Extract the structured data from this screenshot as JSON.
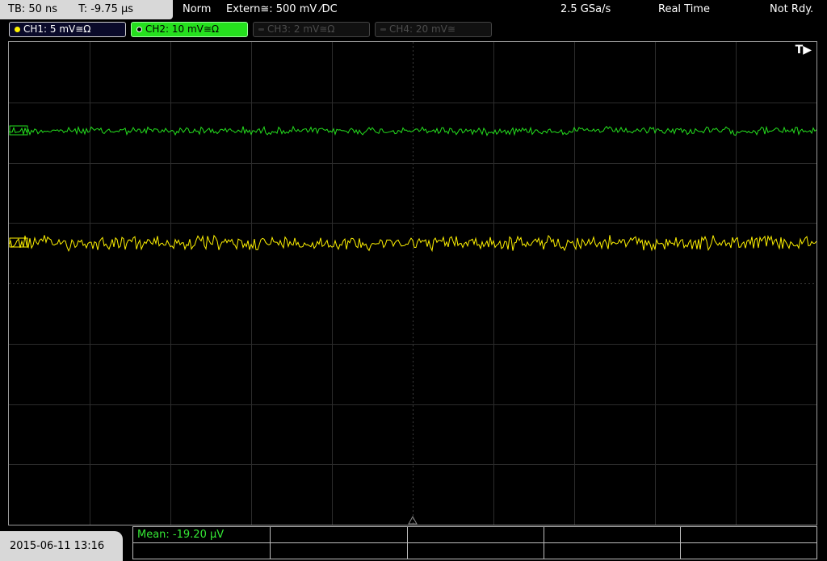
{
  "header": {
    "timebase": "TB: 50 ns",
    "trigger_time": "T: -9.75 µs",
    "trigger_mode": "Norm",
    "trigger_source": "Extern≅: 500 mV ⁄DC",
    "sample_rate": "2.5 GSa/s",
    "acquisition": "Real Time",
    "status": "Not Rdy."
  },
  "channels": [
    {
      "label": "CH1: 5 mV≅Ω",
      "color": "#fff200",
      "active": true
    },
    {
      "label": "CH2: 10 mV≅Ω",
      "color": "#25e01e",
      "active": true
    },
    {
      "label": "CH3: 2 mV≅Ω",
      "color": "#4c4c4c",
      "active": false
    },
    {
      "label": "CH4: 20 mV≅",
      "color": "#4c4c4c",
      "active": false
    }
  ],
  "screen": {
    "trigger_marker": "T▶"
  },
  "footer": {
    "datetime": "2015-06-11 13:16",
    "measurement": "Mean: -19.20 µV"
  }
}
